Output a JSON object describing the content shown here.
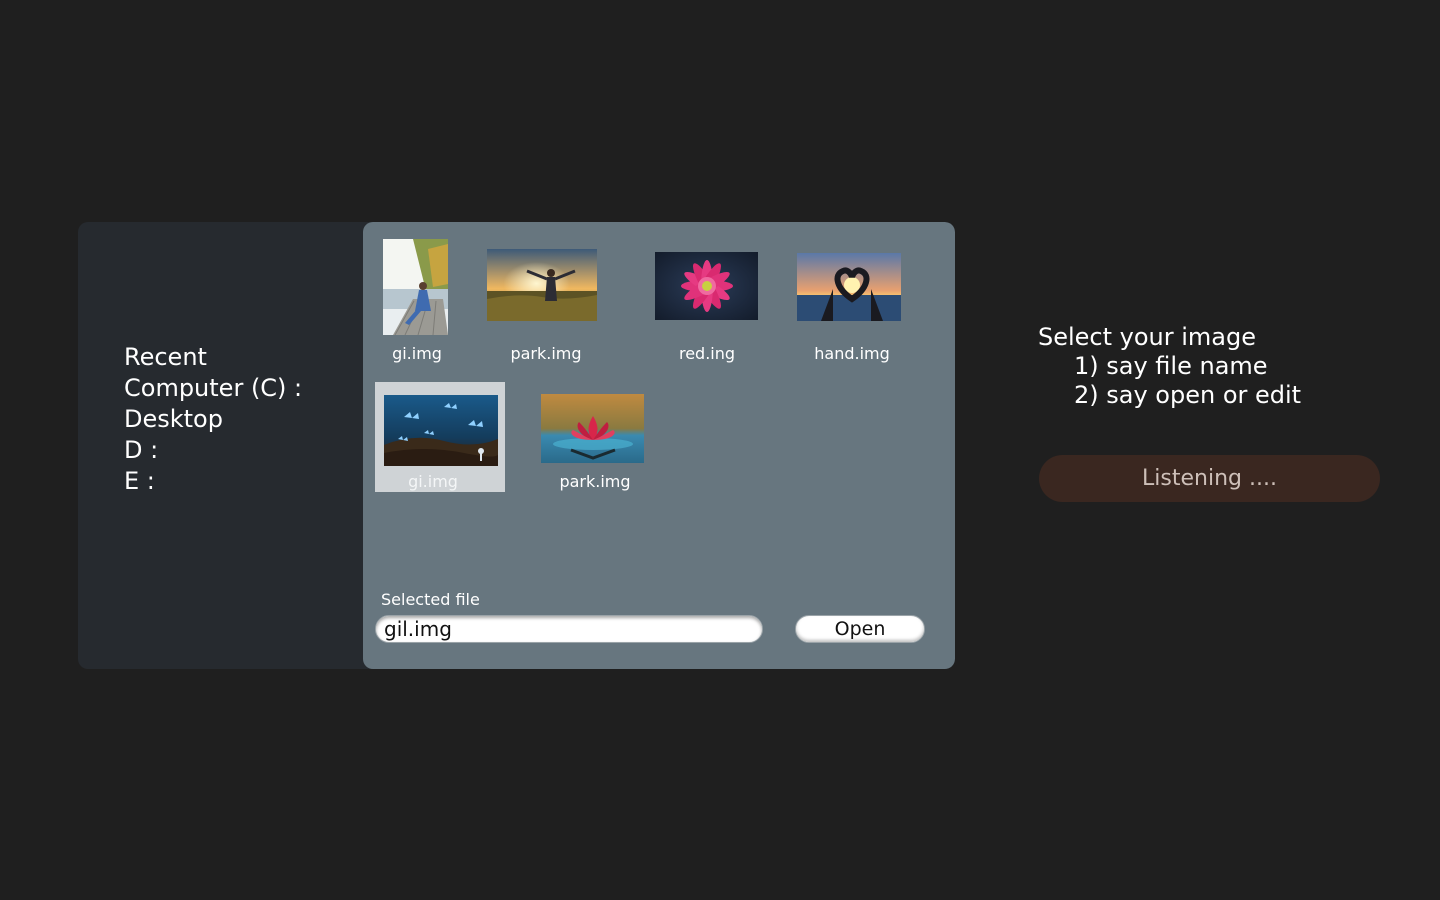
{
  "sidebar": {
    "items": [
      {
        "label": "Recent"
      },
      {
        "label": "Computer (C) :"
      },
      {
        "label": "Desktop"
      },
      {
        "label": "D :"
      },
      {
        "label": "E :"
      }
    ]
  },
  "files": [
    {
      "name": "gi.img",
      "icon": "woman-on-dock-thumbnail",
      "selected": false
    },
    {
      "name": "park.img",
      "icon": "sunset-field-thumbnail",
      "selected": false
    },
    {
      "name": "red.ing",
      "icon": "pink-flower-thumbnail",
      "selected": false
    },
    {
      "name": "hand.img",
      "icon": "heart-hands-thumbnail",
      "selected": false
    },
    {
      "name": "gi.img",
      "icon": "blue-butterflies-thumbnail",
      "selected": true
    },
    {
      "name": "park.img",
      "icon": "water-lily-thumbnail",
      "selected": false
    }
  ],
  "selected_file": {
    "label": "Selected file",
    "value": "gil.img"
  },
  "open_button": {
    "label": "Open"
  },
  "instructions": {
    "title": "Select your image",
    "steps": [
      "1) say file name",
      "2) say open or edit"
    ]
  },
  "listening": {
    "label": "Listening ...."
  },
  "colors": {
    "background": "#1f1f1f",
    "panel": "#262a2f",
    "content": "#67767f",
    "selection": "#cfd3d6",
    "listening_bg": "#3a2720"
  }
}
